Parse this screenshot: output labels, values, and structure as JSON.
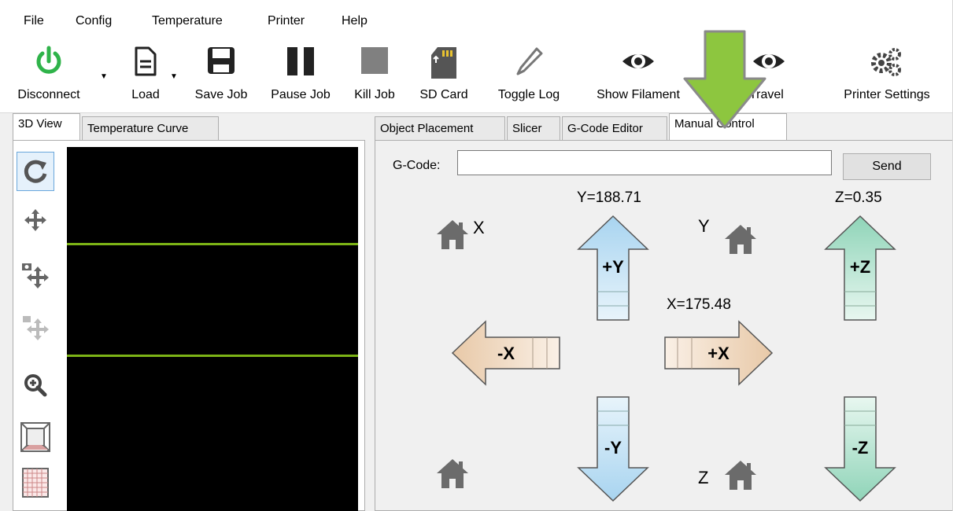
{
  "menu": [
    "File",
    "Config",
    "Temperature",
    "Printer",
    "Help"
  ],
  "toolbar": {
    "disconnect": "Disconnect",
    "load": "Load",
    "save_job": "Save Job",
    "pause_job": "Pause Job",
    "kill_job": "Kill Job",
    "sd_card": "SD Card",
    "toggle_log": "Toggle Log",
    "show_filament": "Show Filament",
    "show_travel": "Travel",
    "printer_settings": "Printer Settings"
  },
  "left_tabs": [
    "3D View",
    "Temperature Curve"
  ],
  "right_tabs": [
    "Object Placement",
    "Slicer",
    "G-Code Editor",
    "Manual Control"
  ],
  "manual_control": {
    "gcode_label": "G-Code:",
    "gcode_value": "",
    "send_label": "Send",
    "y_position": "Y=188.71",
    "z_position": "Z=0.35",
    "x_position": "X=175.48",
    "home_x_label": "X",
    "home_y_label": "Y",
    "home_z_label": "Z",
    "plus_y": "+Y",
    "minus_y": "-Y",
    "plus_x": "+X",
    "minus_x": "-X",
    "plus_z": "+Z",
    "minus_z": "-Z"
  },
  "colors": {
    "y_arrow": "#a8d4f0",
    "x_arrow": "#e8c9a8",
    "z_arrow": "#8fd4b8",
    "highlight_arrow": "#8dc63f",
    "viewport_line": "#7cb316",
    "disconnect_icon": "#2fb34a"
  },
  "icons": [
    "power-icon",
    "document-icon",
    "floppy-icon",
    "pause-icon",
    "stop-icon",
    "sd-card-icon",
    "pencil-icon",
    "eye-icon",
    "gears-icon",
    "home-icon",
    "rotate-icon",
    "move-icon",
    "zoom-icon"
  ]
}
